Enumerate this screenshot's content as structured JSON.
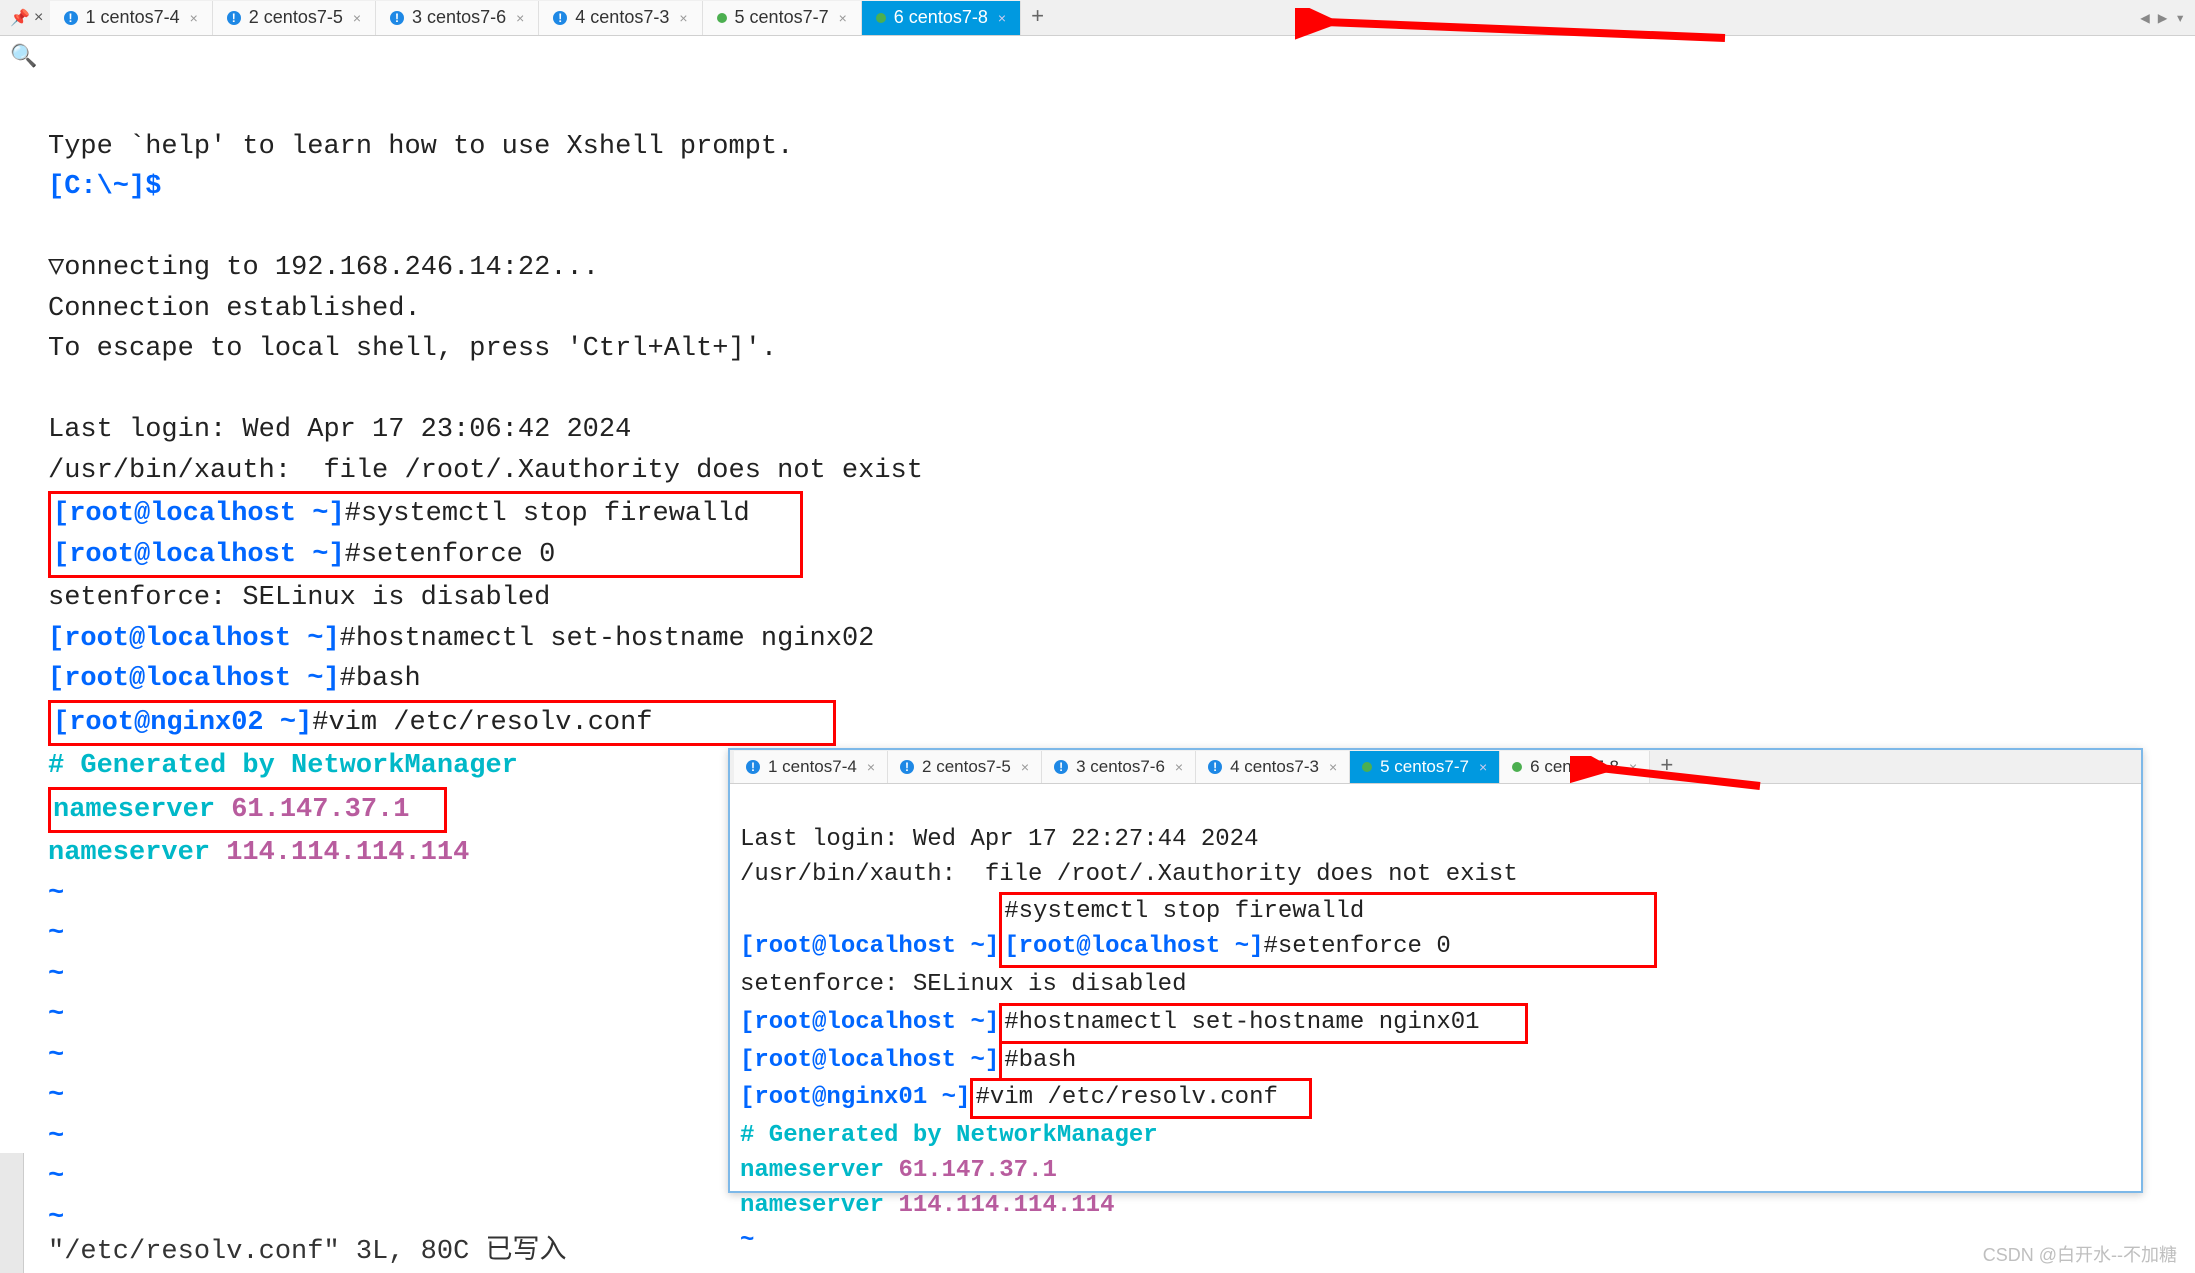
{
  "main_tabs": [
    {
      "icon_type": "info",
      "label": "1 centos7-4"
    },
    {
      "icon_type": "info",
      "label": "2 centos7-5"
    },
    {
      "icon_type": "info",
      "label": "3 centos7-6"
    },
    {
      "icon_type": "info",
      "label": "4 centos7-3"
    },
    {
      "icon_type": "dot-green",
      "label": "5 centos7-7"
    },
    {
      "icon_type": "dot-green",
      "label": "6 centos7-8",
      "active": true
    }
  ],
  "overlay_tabs": [
    {
      "icon_type": "info",
      "label": "1 centos7-4"
    },
    {
      "icon_type": "info",
      "label": "2 centos7-5"
    },
    {
      "icon_type": "info",
      "label": "3 centos7-6"
    },
    {
      "icon_type": "info",
      "label": "4 centos7-3"
    },
    {
      "icon_type": "dot-green",
      "label": "5 centos7-7",
      "active": true
    },
    {
      "icon_type": "dot-green",
      "label": "6 centos7-8"
    }
  ],
  "terminal": {
    "help_line": "Type `help' to learn how to use Xshell prompt.",
    "prompt_local": "[C:\\~]$",
    "connecting": "▽onnecting to 192.168.246.14:22...",
    "conn_est": "Connection established.",
    "escape": "To escape to local shell, press 'Ctrl+Alt+]'.",
    "last_login": "Last login: Wed Apr 17 23:06:42 2024",
    "xauth": "/usr/bin/xauth:  file /root/.Xauthority does not exist",
    "prompt_root": "[root@localhost ~]",
    "prompt_nginx02": "[root@nginx02 ~]",
    "cmd_firewall": "#systemctl stop firewalld",
    "cmd_setenforce": "#setenforce 0",
    "setenforce_out": "setenforce: SELinux is disabled",
    "cmd_hostname02": "#hostnamectl set-hostname nginx02",
    "cmd_bash": "#bash",
    "cmd_vim": "#vim /etc/resolv.conf",
    "vim_comment": "# Generated by NetworkManager",
    "ns_label": "nameserver ",
    "ns1": "61.147.37.1",
    "ns2": "114.114.114.114",
    "tilde": "~",
    "status_line": "\"/etc/resolv.conf\" 3L, 80C 已写入"
  },
  "overlay_terminal": {
    "last_login": "Last login: Wed Apr 17 22:27:44 2024",
    "xauth": "/usr/bin/xauth:  file /root/.Xauthority does not exist",
    "prompt_root": "[root@localhost ~]",
    "prompt_nginx01": "[root@nginx01 ~]",
    "cmd_firewall": "#systemctl stop firewalld",
    "cmd_setenforce": "#setenforce 0",
    "setenforce_out": "setenforce: SELinux is disabled",
    "cmd_hostname01": "#hostnamectl set-hostname nginx01",
    "cmd_bash": "#bash",
    "cmd_vim": "#vim /etc/resolv.conf",
    "vim_comment": "# Generated by NetworkManager",
    "ns_label": "nameserver ",
    "ns1": "61.147.37.1",
    "ns2": "114.114.114.114",
    "tilde": "~"
  },
  "watermark": "CSDN @白开水--不加糖",
  "icons": {
    "pin": "📌",
    "close": "×",
    "search": "🔍",
    "add": "+",
    "left": "◀",
    "right": "▶",
    "dropdown": "▾"
  }
}
